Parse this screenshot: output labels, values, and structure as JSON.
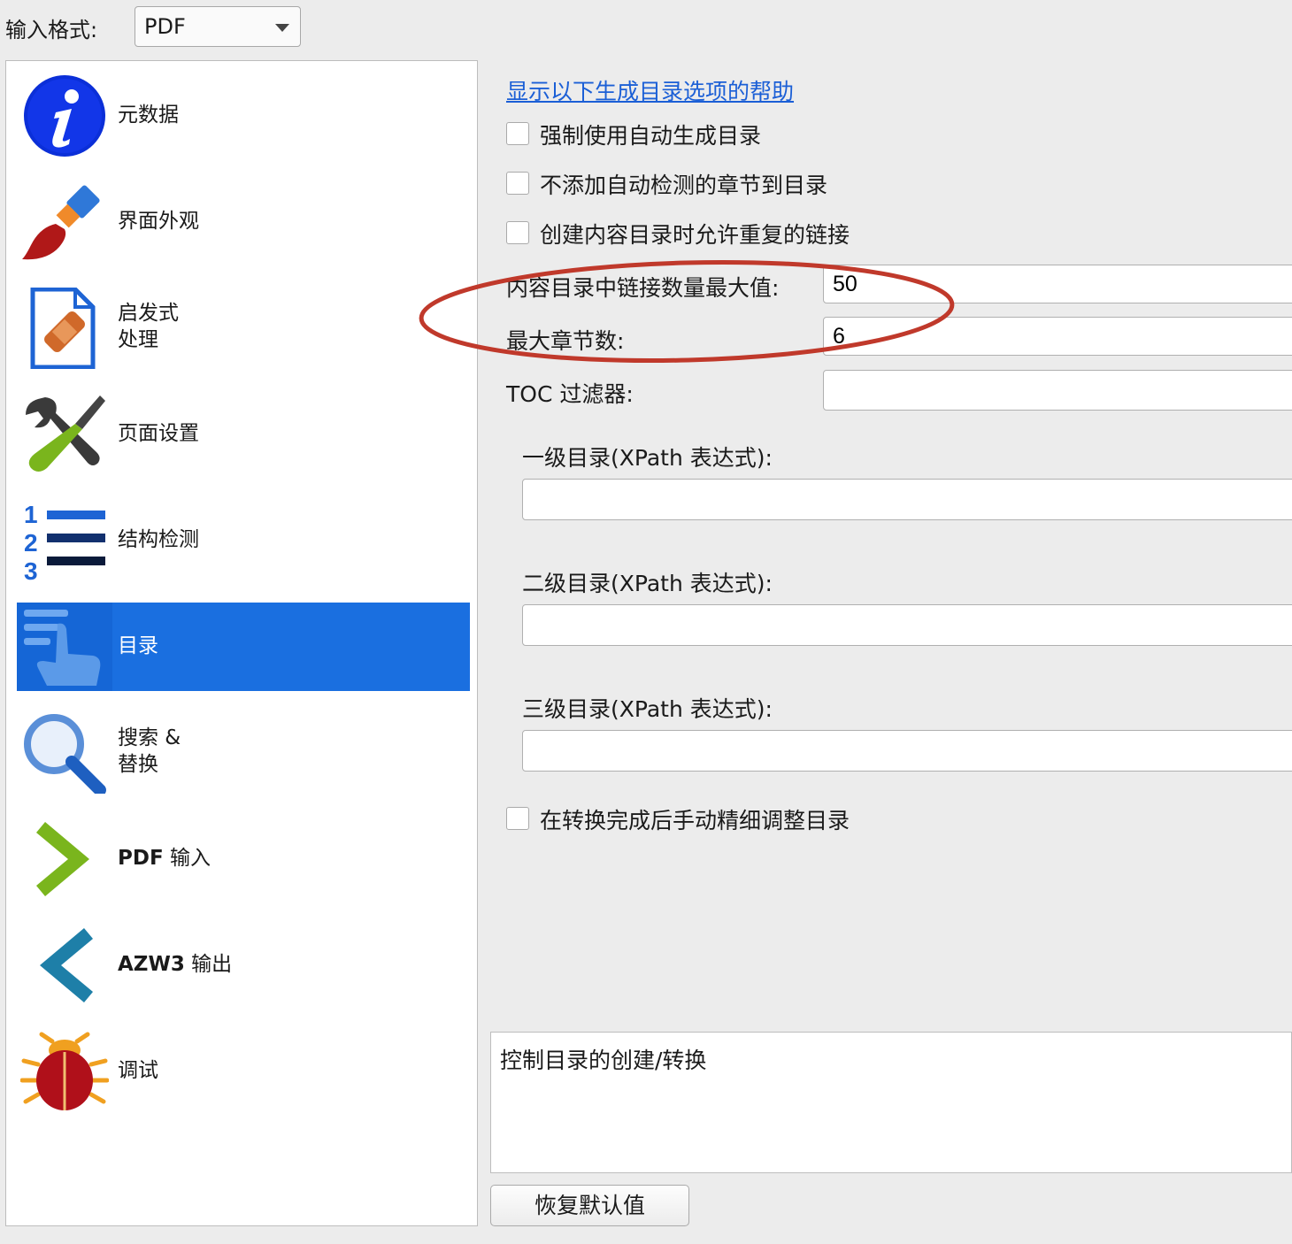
{
  "header": {
    "input_format_label": "输入格式:",
    "input_format_value": "PDF"
  },
  "sidebar": {
    "items": [
      {
        "label": "元数据",
        "icon": "info-icon"
      },
      {
        "label": "界面外观",
        "icon": "paintbrush-icon"
      },
      {
        "label": "启发式",
        "label2": "处理",
        "icon": "bandaged-document-icon"
      },
      {
        "label": "页面设置",
        "icon": "tools-icon"
      },
      {
        "label": "结构检测",
        "icon": "numbered-list-icon"
      },
      {
        "label": "目录",
        "icon": "toc-icon",
        "selected": true
      },
      {
        "label": "搜索 &",
        "label2": "替换",
        "icon": "magnifier-icon"
      },
      {
        "label_bold": "PDF",
        "label": " 输入",
        "icon": "chevron-right-icon"
      },
      {
        "label_bold": "AZW3",
        "label": " 输出",
        "icon": "chevron-left-icon"
      },
      {
        "label": "调试",
        "icon": "bug-icon"
      }
    ]
  },
  "main": {
    "help_link": "显示以下生成目录选项的帮助",
    "checkboxes": [
      {
        "label": "强制使用自动生成目录",
        "checked": false
      },
      {
        "label": "不添加自动检测的章节到目录",
        "checked": false
      },
      {
        "label": "创建内容目录时允许重复的链接",
        "checked": false
      }
    ],
    "max_links_label": "内容目录中链接数量最大值:",
    "max_links_value": "50",
    "max_chapters_label": "最大章节数:",
    "max_chapters_value": "6",
    "toc_filter_label": "TOC 过滤器:",
    "toc_filter_value": "",
    "level1_label": "一级目录(XPath 表达式):",
    "level1_value": "",
    "level2_label": "二级目录(XPath 表达式):",
    "level2_value": "",
    "level3_label": "三级目录(XPath 表达式):",
    "level3_value": "",
    "manual_tweak_label": "在转换完成后手动精细调整目录",
    "manual_tweak_checked": false,
    "description": "控制目录的创建/转换",
    "reset_button": "恢复默认值"
  },
  "colors": {
    "selection": "#1a6fe0",
    "link": "#1b5fd6",
    "annotation_ellipse": "#c0392b"
  }
}
